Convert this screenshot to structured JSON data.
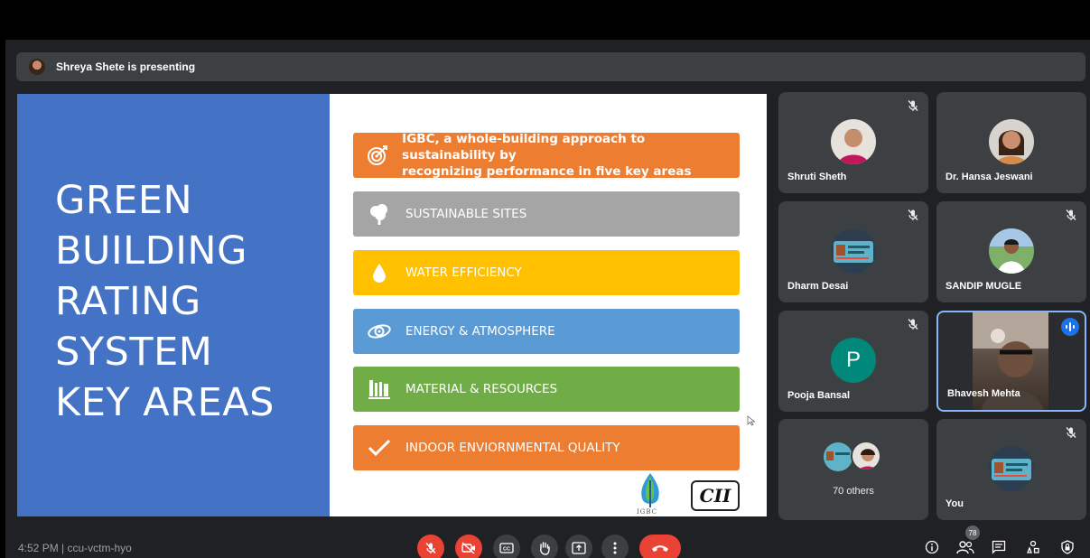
{
  "presenting_bar": {
    "text": "Shreya Shete is presenting"
  },
  "slide": {
    "title_lines": [
      "GREEN",
      "BUILDING",
      "RATING",
      "SYSTEM",
      "KEY AREAS"
    ],
    "bars": [
      {
        "line1": "IGBC, a whole-building approach to sustainability by",
        "line2": "recognizing performance in five key areas",
        "icon": "target-icon",
        "color": "#ed7d31"
      },
      {
        "label": "SUSTAINABLE SITES",
        "icon": "tree-icon",
        "color": "#a5a5a5"
      },
      {
        "label": "WATER EFFICIENCY",
        "icon": "water-drop-icon",
        "color": "#ffc000"
      },
      {
        "label": "ENERGY & ATMOSPHERE",
        "icon": "eye-orbit-icon",
        "color": "#5b9bd5"
      },
      {
        "label": "MATERIAL & RESOURCES",
        "icon": "library-icon",
        "color": "#70ad47"
      },
      {
        "label": "INDOOR ENVIORNMENTAL QUALITY",
        "icon": "checkmark-icon",
        "color": "#ed7d31"
      }
    ],
    "logo_igbc_text": "IGBC",
    "logo_cii_text": "CII"
  },
  "participants": [
    {
      "name": "Shruti Sheth",
      "muted": true
    },
    {
      "name": "Dr. Hansa Jeswani",
      "muted": false
    },
    {
      "name": "Dharm Desai",
      "muted": true
    },
    {
      "name": "SANDIP MUGLE",
      "muted": true
    },
    {
      "name": "Pooja Bansal",
      "muted": true,
      "initial": "P"
    },
    {
      "name": "Bhavesh Mehta",
      "speaking": true
    },
    {
      "others_label": "70 others"
    },
    {
      "name": "You",
      "muted": true
    }
  ],
  "bottom_bar": {
    "time_label": "4:52 PM  |  ccu-vctm-hyo",
    "participant_count": "78"
  },
  "colors": {
    "meet_bg": "#202124",
    "tile_bg": "#3c4043",
    "end_call": "#ea4335",
    "slide_blue": "#4472c4"
  }
}
